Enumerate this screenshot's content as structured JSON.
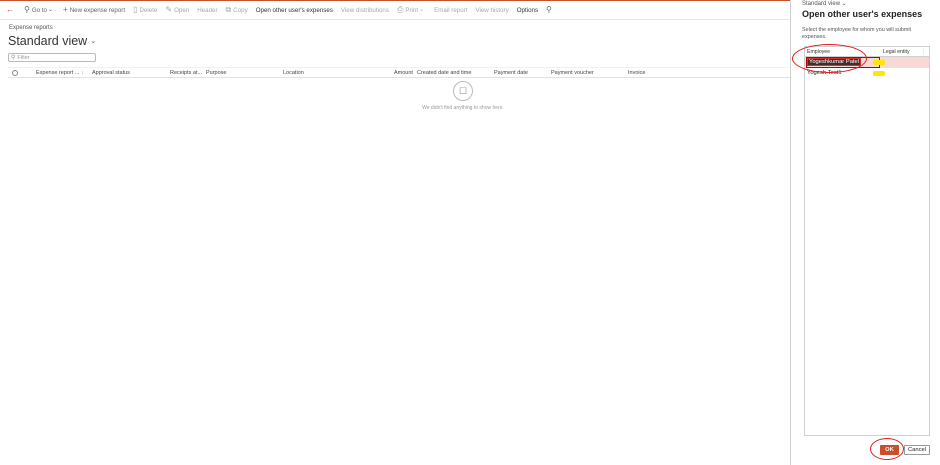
{
  "toolbar": {
    "back_icon": "back-arrow-icon",
    "goto": "Go to",
    "new_report": "New expense report",
    "delete": "Delete",
    "open": "Open",
    "header": "Header",
    "copy": "Copy",
    "open_other": "Open other user's expenses",
    "view_distributions": "View distributions",
    "print": "Print",
    "email_report": "Email report",
    "view_history": "View history",
    "options": "Options"
  },
  "main": {
    "breadcrumb": "Expense reports",
    "view_title": "Standard view",
    "filter_placeholder": "Filter",
    "columns": [
      "Expense report ...",
      "Approval status",
      "Receipts at...",
      "Purpose",
      "Location",
      "Amount",
      "Created date and time",
      "Payment date",
      "Payment voucher",
      "Invoice"
    ],
    "empty_text": "We didn't find anything to show here."
  },
  "panel": {
    "view": "Standard view",
    "title": "Open other user's expenses",
    "description": "Select the employee for whom you will submit expenses.",
    "col_employee": "Employee",
    "col_legal": "Legal entity",
    "rows": [
      {
        "name": "Yogeshkumar Patel"
      },
      {
        "name": "Yogesh.Test1"
      }
    ],
    "ok": "OK",
    "cancel": "Cancel"
  },
  "colors": {
    "accent": "#c94f2a",
    "annotation": "#e01e1e",
    "highlight": "#ffe600"
  }
}
